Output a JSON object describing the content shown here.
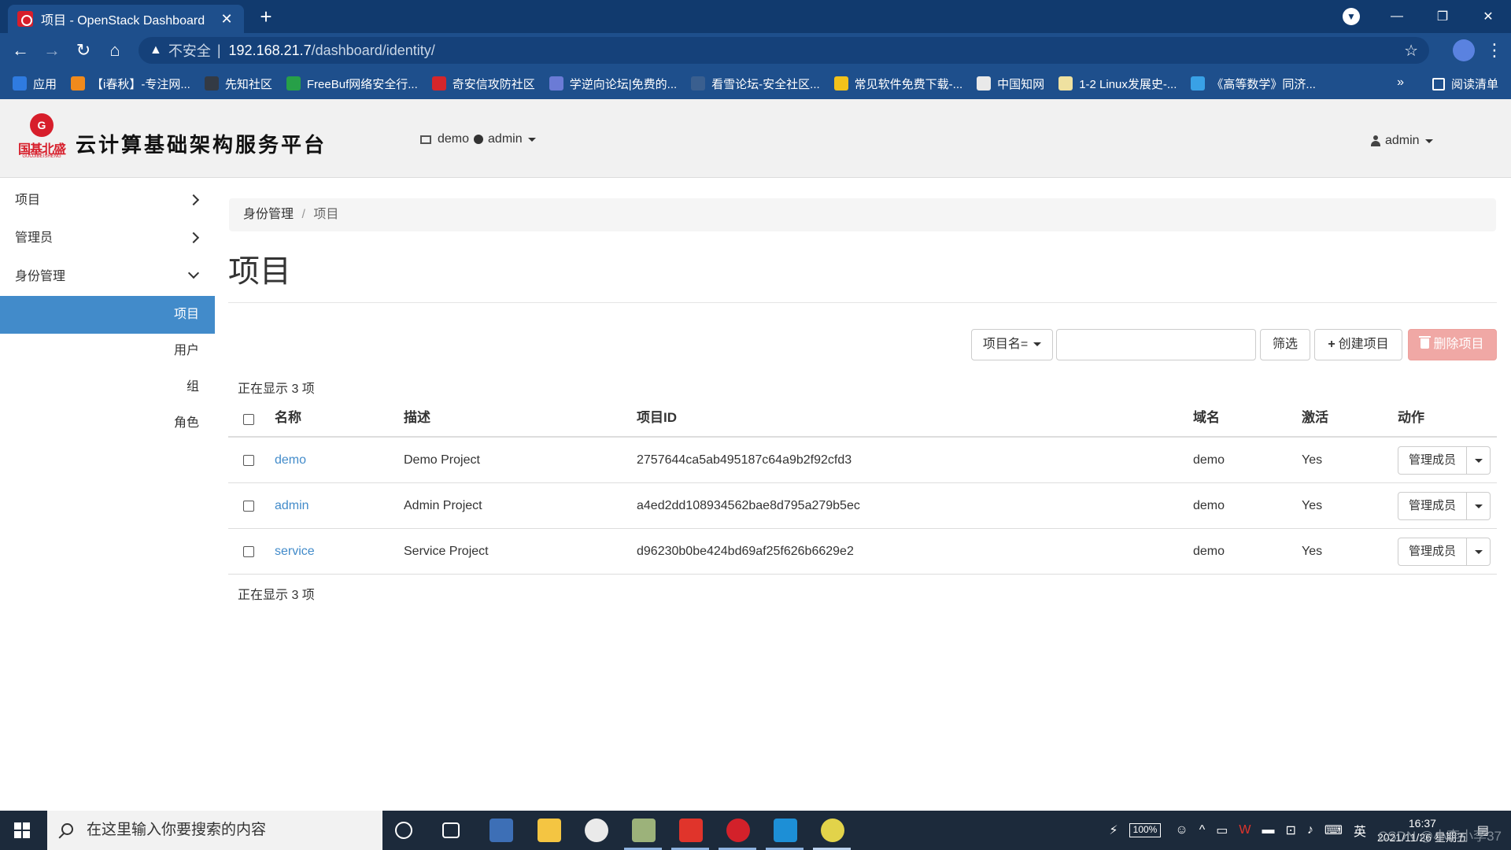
{
  "browser": {
    "tab_title": "项目 - OpenStack Dashboard",
    "tab_close": "✕",
    "new_tab": "+",
    "url_warning": "不安全",
    "url_separator": "|",
    "url_host": "192.168.21.7",
    "url_path": "/dashboard/identity/",
    "bookmarks": [
      {
        "label": "应用",
        "color": "#2f7be0"
      },
      {
        "label": "【i春秋】-专注网...",
        "color": "#f08a1c"
      },
      {
        "label": "先知社区",
        "color": "#333a44"
      },
      {
        "label": "FreeBuf网络安全行...",
        "color": "#27a048"
      },
      {
        "label": "奇安信攻防社区",
        "color": "#d4262b"
      },
      {
        "label": "学逆向论坛|免费的...",
        "color": "#6b7bd6"
      },
      {
        "label": "看雪论坛-安全社区...",
        "color": "#3a5f8f"
      },
      {
        "label": "常见软件免费下载-...",
        "color": "#f2c21b"
      },
      {
        "label": "中国知网",
        "color": "#e9e9e9"
      },
      {
        "label": "1-2 Linux发展史-...",
        "color": "#efe1a0"
      },
      {
        "label": "《高等数学》同济...",
        "color": "#39a1e6"
      }
    ],
    "bookmarks_more": "»",
    "reading_list": "阅读清单"
  },
  "header": {
    "logo_text_cn": "国基北盛",
    "logo_text_en": "GUOJIBEISHENG",
    "brand_title": "云计算基础架构服务平台",
    "context_domain": "demo",
    "context_project": "admin",
    "user": "admin"
  },
  "sidebar": {
    "sections": [
      {
        "label": "项目"
      },
      {
        "label": "管理员"
      },
      {
        "label": "身份管理"
      }
    ],
    "sub_items": [
      {
        "label": "项目"
      },
      {
        "label": "用户"
      },
      {
        "label": "组"
      },
      {
        "label": "角色"
      }
    ]
  },
  "breadcrumb": {
    "parent": "身份管理",
    "separator": "/",
    "current": "项目"
  },
  "page_title": "项目",
  "toolbar": {
    "filter_field": "项目名=",
    "filter_placeholder": "",
    "filter_label": "筛选",
    "create_label": "创建项目",
    "delete_label": "删除项目"
  },
  "count_top": "正在显示 3 项",
  "count_bottom": "正在显示 3 项",
  "table": {
    "headers": {
      "name": "名称",
      "description": "描述",
      "project_id": "项目ID",
      "domain": "域名",
      "enabled": "激活",
      "actions": "动作"
    },
    "rows": [
      {
        "name": "demo",
        "description": "Demo Project",
        "project_id": "2757644ca5ab495187c64a9b2f92cfd3",
        "domain": "demo",
        "enabled": "Yes",
        "action": "管理成员"
      },
      {
        "name": "admin",
        "description": "Admin Project",
        "project_id": "a4ed2dd108934562bae8d795a279b5ec",
        "domain": "demo",
        "enabled": "Yes",
        "action": "管理成员"
      },
      {
        "name": "service",
        "description": "Service Project",
        "project_id": "d96230b0be424bd69af25f626b6629e2",
        "domain": "demo",
        "enabled": "Yes",
        "action": "管理成员"
      }
    ]
  },
  "taskbar": {
    "search_placeholder": "在这里输入你要搜索的内容",
    "battery": "100%",
    "ime": "英",
    "time": "16:37",
    "date": "2021/11/26 星期五",
    "watermark": "CSDN @小李小李37"
  },
  "colors": {
    "brand_red": "#d71e2b",
    "accent_blue": "#428bca",
    "delete_disabled": "#f0a8a5",
    "browser_frame": "#1e4f8c"
  }
}
